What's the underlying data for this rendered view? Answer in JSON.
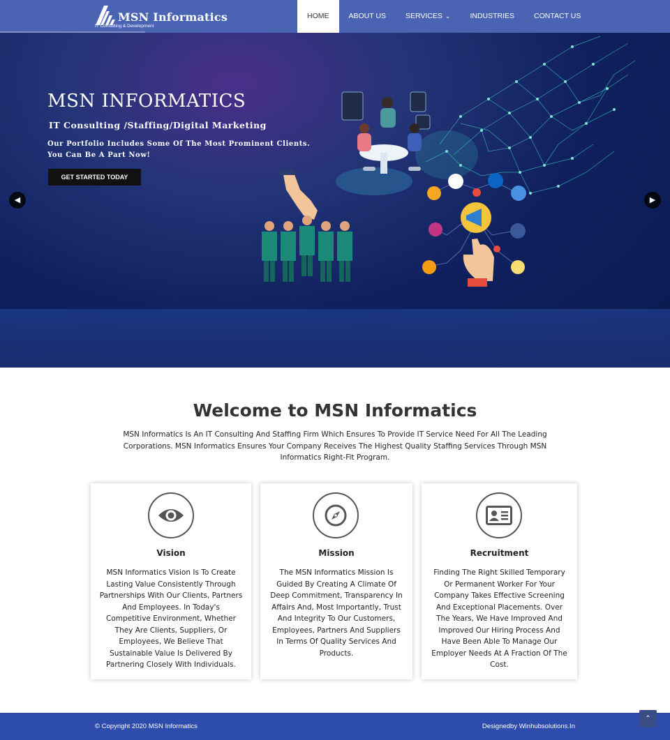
{
  "header": {
    "logo_text": "MSN Informatics",
    "logo_tagline": "IT Consulting & Development",
    "nav": [
      {
        "label": "HOME",
        "active": true
      },
      {
        "label": "ABOUT US"
      },
      {
        "label": "SERVICES"
      },
      {
        "label": "INDUSTRIES"
      },
      {
        "label": "CONTACT US"
      }
    ]
  },
  "hero": {
    "title": "MSN INFORMATICS",
    "subtitle": "IT Consulting /Staffing/Digital Marketing",
    "description": "Our Portfolio Includes Some Of The Most Prominent Clients. You Can Be A Part Now!",
    "cta_label": "GET STARTED TODAY",
    "prev_icon": "chevron-left-icon",
    "next_icon": "chevron-right-icon"
  },
  "welcome": {
    "title": "Welcome to MSN Informatics",
    "text": "MSN Informatics Is An IT Consulting And Staffing Firm Which Ensures To Provide IT Service Need For All The Leading Corporations. MSN Informatics Ensures Your Company Receives The Highest Quality Staffing Services Through MSN Informatics Right-Fit Program."
  },
  "cards": [
    {
      "icon": "eye-icon",
      "title": "Vision",
      "text": "MSN Informatics Vision Is To Create Lasting Value Consistently Through Partnerships With Our Clients, Partners And Employees. In Today's Competitive Environment, Whether They Are Clients, Suppliers, Or Employees, We Believe That Sustainable Value Is Delivered By Partnering Closely With Individuals."
    },
    {
      "icon": "compass-icon",
      "title": "Mission",
      "text": "The MSN Informatics Mission Is Guided By Creating A Climate Of Deep Commitment, Transparency In Affairs And, Most Importantly, Trust And Integrity To Our Customers, Employees, Partners And Suppliers In Terms Of Quality Services And Products."
    },
    {
      "icon": "id-card-icon",
      "title": "Recruitment",
      "text": "Finding The Right Skilled Temporary Or Permanent Worker For Your Company Takes Effective Screening And Exceptional Placements. Over The Years, We Have Improved And Improved Our Hiring Process And Have Been Able To Manage Our Employer Needs At A Fraction Of The Cost."
    }
  ],
  "footer": {
    "copyright": "© Copyright 2020 MSN Informatics",
    "designed_by": "Designedby Winhubsolutions.In",
    "scroll_top_icon": "chevron-up-icon"
  },
  "colors": {
    "navbar": "#4a63b3",
    "footer": "#2d4cac",
    "hero_dark": "#0b1a4f",
    "button_dark": "#111111"
  }
}
